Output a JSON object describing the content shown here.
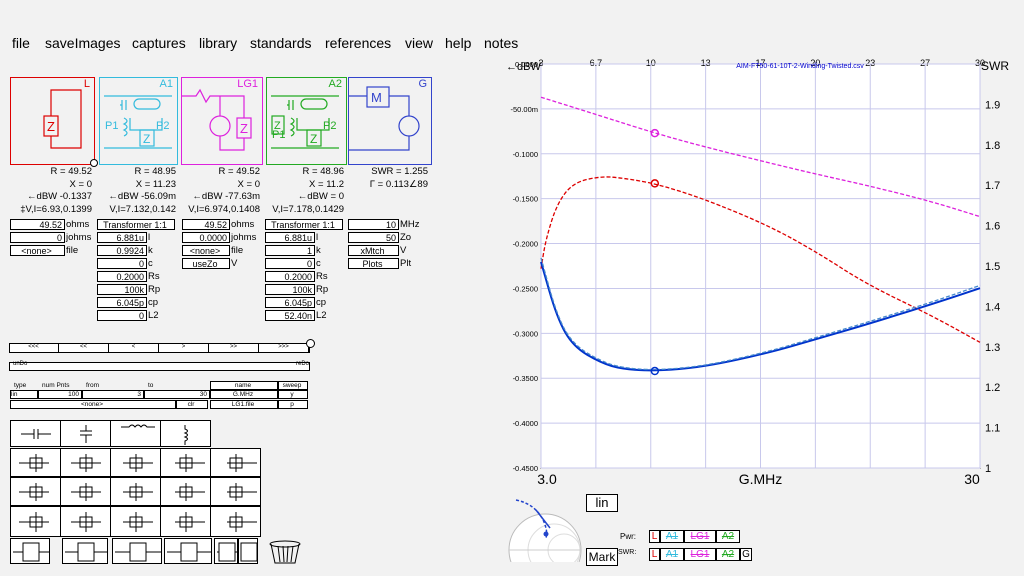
{
  "menu": [
    "file",
    "saveImages",
    "captures",
    "library",
    "standards",
    "references",
    "view",
    "help",
    "notes"
  ],
  "blocks": [
    {
      "title": "L",
      "color": "#dd0000"
    },
    {
      "title": "A1",
      "color": "#33bbdd"
    },
    {
      "title": "LG1",
      "color": "#dd22dd"
    },
    {
      "title": "A2",
      "color": "#22aa22"
    },
    {
      "title": "G",
      "color": "#3344cc"
    }
  ],
  "info": [
    [
      "R = 49.52",
      "X = 0",
      "←dBW -0.1337",
      "‡V,I=6.93,0.1399"
    ],
    [
      "R = 48.95",
      "X = 11.23",
      "←dBW -56.09m",
      "V,I=7.132,0.142"
    ],
    [
      "R = 49.52",
      "X = 0",
      "←dBW -77.63m",
      "V,I=6.974,0.1408"
    ],
    [
      "R = 48.96",
      "X = 11.2",
      "←dBW = 0",
      "V,I=7.178,0.1429"
    ],
    [
      "SWR = 1.255",
      "Γ = 0.113∠89"
    ]
  ],
  "col0": {
    "v1": "49.52",
    "u1": "ohms",
    "v2": "0",
    "u2": "johms",
    "v3": "<none>",
    "u3": "file"
  },
  "col1": {
    "head": "Transformer 1:1",
    "vals": [
      "6.881u",
      "0.9924",
      "0",
      "0.2000",
      "100k",
      "6.045p",
      "0"
    ],
    "units": [
      "l",
      "k",
      "c",
      "Rs",
      "Rp",
      "cp",
      "L2"
    ]
  },
  "col2": {
    "v1": "49.52",
    "u1": "ohms",
    "v2": "0.0000",
    "u2": "johms",
    "v3": "<none>",
    "u3": "file",
    "v4": "useZo",
    "u4": "V"
  },
  "col3": {
    "head": "Transformer 1:1",
    "vals": [
      "6.881u",
      "1",
      "0",
      "0.2000",
      "100k",
      "6.045p",
      "52.40n"
    ],
    "units": [
      "l",
      "k",
      "c",
      "Rs",
      "Rp",
      "cp",
      "L2"
    ]
  },
  "col4": {
    "vals": [
      "10",
      "50",
      "xMtch",
      "Plots"
    ],
    "units": [
      "MHz",
      "Zo",
      "V",
      "Plt"
    ]
  },
  "nav": {
    "items": [
      "<<<",
      "<<",
      "<",
      ">",
      ">>",
      ">>>"
    ],
    "undo": "unDo",
    "redo": "reDo"
  },
  "sweep": {
    "h_type": "type",
    "h_num": "num Pnts",
    "h_from": "from",
    "h_to": "to",
    "h_name": "name",
    "h_sweep": "sweep",
    "type": "lin",
    "num": "100",
    "from": "3",
    "to": "30",
    "name": "G.MHz",
    "sweep": "y",
    "none": "<none>",
    "clr": "clr",
    "file": "LG1.file",
    "p": "p"
  },
  "chart_data": {
    "type": "line",
    "title": "AIM-FT50-61-10T-2-Winding-Twisted.csv",
    "xlabel": "G.MHz",
    "top_ticks": [
      "3",
      "6.7",
      "10",
      "13",
      "17",
      "20",
      "23",
      "27",
      "30"
    ],
    "x_tick_labels": [
      "3.0",
      "30"
    ],
    "xlim": [
      3,
      30
    ],
    "left_label": "←dBW",
    "left_ticks": [
      "0.0000",
      "-50.00m",
      "-0.1000",
      "-0.1500",
      "-0.2000",
      "-0.2500",
      "-0.3000",
      "-0.3500",
      "-0.4000",
      "-0.4500"
    ],
    "ylim_left": [
      -0.45,
      0
    ],
    "right_label": "SWR",
    "right_ticks": [
      "1.9",
      "1.8",
      "1.7",
      "1.6",
      "1.5",
      "1.4",
      "1.3",
      "1.2",
      "1.1",
      "1"
    ],
    "ylim_right": [
      1,
      2.0
    ],
    "series": [
      {
        "color": "#dd22dd",
        "axis": "left",
        "dashed": true,
        "x": [
          3,
          6.7,
          10,
          13,
          17,
          20,
          23,
          27,
          30
        ],
        "y": [
          -0.037,
          -0.058,
          -0.077,
          -0.092,
          -0.11,
          -0.123,
          -0.135,
          -0.153,
          -0.17
        ]
      },
      {
        "color": "#dd0000",
        "axis": "left",
        "dashed": true,
        "x": [
          3,
          3.3,
          4,
          5,
          6.7,
          8,
          10,
          13,
          17,
          20,
          23,
          27,
          30
        ],
        "y": [
          -0.228,
          -0.195,
          -0.155,
          -0.132,
          -0.125,
          -0.127,
          -0.133,
          -0.15,
          -0.18,
          -0.21,
          -0.245,
          -0.28,
          -0.31
        ]
      },
      {
        "color": "#0033cc",
        "axis": "right",
        "dashed": false,
        "x": [
          3,
          4,
          5,
          6.7,
          8,
          10,
          13,
          17,
          20,
          23,
          27,
          30
        ],
        "y": [
          1.51,
          1.37,
          1.3,
          1.26,
          1.245,
          1.24,
          1.25,
          1.285,
          1.32,
          1.355,
          1.405,
          1.445
        ]
      },
      {
        "color": "#4488cc",
        "axis": "right",
        "dashed": true,
        "x": [
          3,
          4,
          5,
          6.7,
          8,
          10,
          13,
          17,
          20,
          23,
          27,
          30
        ],
        "y": [
          1.52,
          1.375,
          1.305,
          1.264,
          1.248,
          1.242,
          1.252,
          1.288,
          1.324,
          1.36,
          1.41,
          1.452
        ]
      }
    ],
    "markers": [
      {
        "x": 10,
        "y": -0.077,
        "color": "#dd22dd"
      },
      {
        "x": 10,
        "y": -0.133,
        "color": "#dd0000"
      },
      {
        "x": 10,
        "y": 1.24,
        "color": "#0033cc",
        "axis": "right"
      }
    ]
  },
  "lin_button": "lin",
  "mark_button": "Mark",
  "legend": {
    "pwr_label": "Pwr:",
    "swr_label": "SWR:",
    "pwr": [
      "L",
      "A1",
      "LG1",
      "A2"
    ],
    "swr": [
      "L",
      "A1",
      "LG1",
      "A2",
      "G"
    ]
  }
}
